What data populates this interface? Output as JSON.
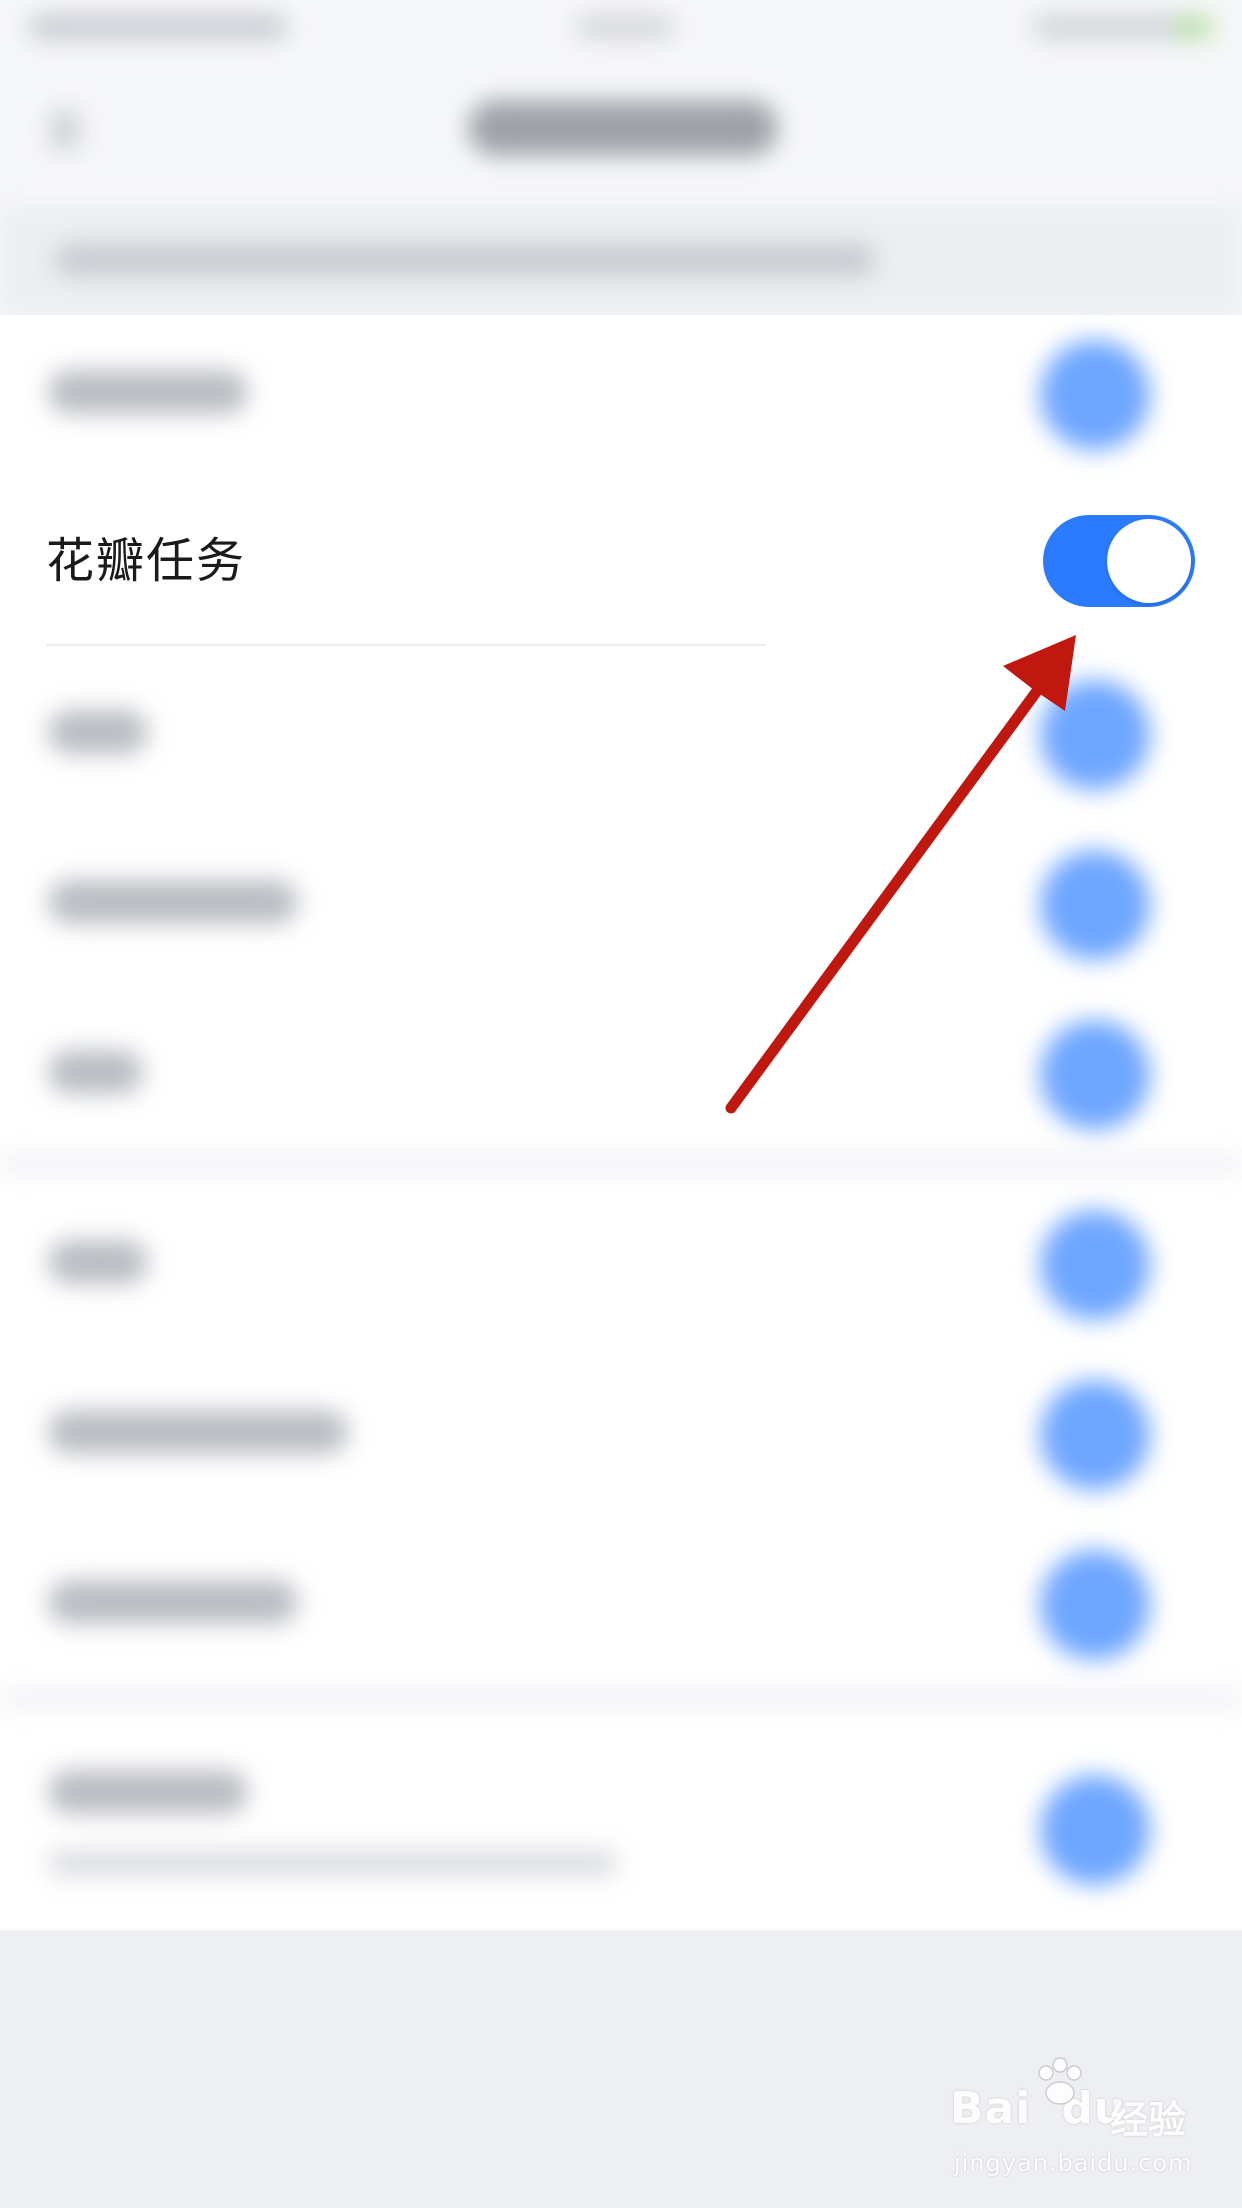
{
  "settings_row": {
    "label": "花瓣任务",
    "toggle_state": "on"
  },
  "colors": {
    "toggle_on": "#2a7bff",
    "arrow": "#c0170f",
    "background": "#f6f7f9"
  },
  "watermark": {
    "brand_latin_1": "Bai",
    "brand_latin_2": "du",
    "brand_cn": "经验",
    "url": "jingyan.baidu.com"
  }
}
